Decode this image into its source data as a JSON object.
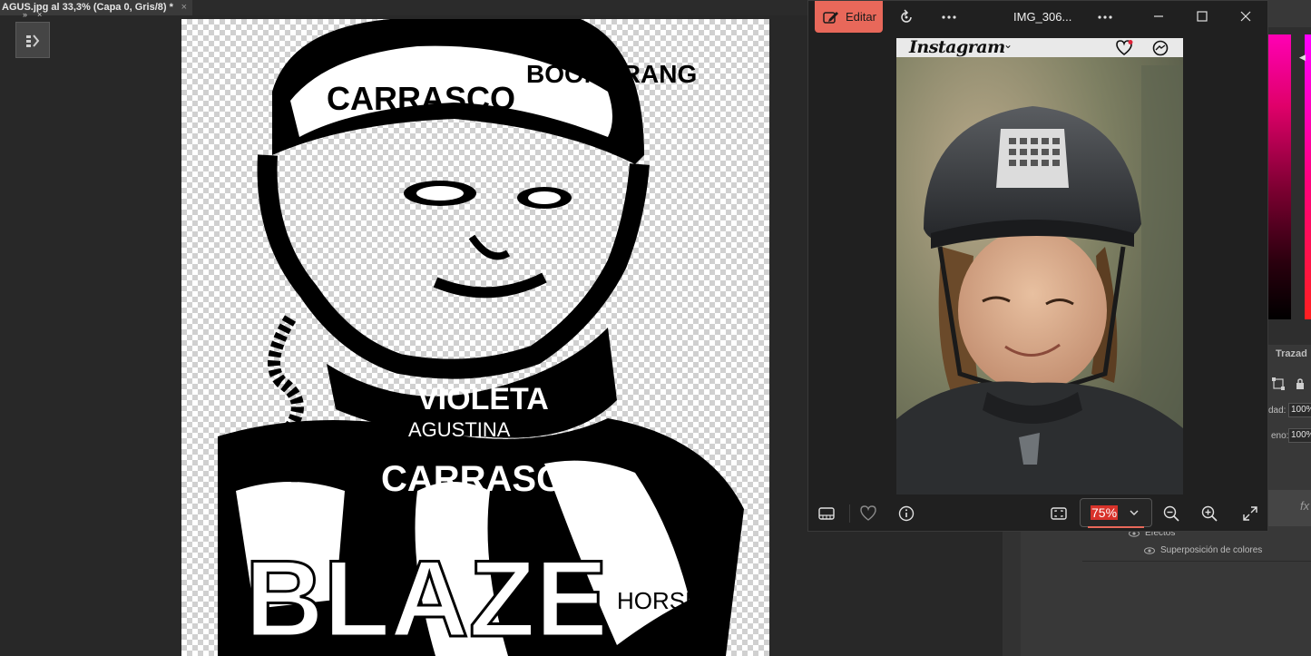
{
  "photoshop": {
    "document_tab": "AGUS.jpg al 33,3% (Capa 0, Gris/8) *",
    "tab_close": "×",
    "tool_header": {
      "expand": "»",
      "close": "×"
    },
    "right_panel": {
      "paths_tab": "Trazad",
      "opacity_label": "dad:",
      "opacity_value": "100%",
      "fill_label": "eno:",
      "fill_value": "100%",
      "fx_label": "fx"
    },
    "layers": {
      "effects_label": "Efectos",
      "color_overlay_label": "Superposición de colores"
    }
  },
  "canvas_artwork": {
    "words": [
      "AGUSTINA",
      "CARRASCO",
      "BOOMERANG",
      "HORSE",
      "BLAZE",
      "VIOLETA"
    ]
  },
  "photos_viewer": {
    "edit_label": "Editar",
    "title": "IMG_306...",
    "photo_header": {
      "app_name": "Instagram",
      "app_chevron": "⌄"
    },
    "zoom_value": "75%"
  },
  "colors": {
    "edit_button": "#e8685a",
    "zoom_highlight": "#d8322a",
    "viewer_bg": "#202020",
    "photoshop_bg": "#282828"
  },
  "icons": {
    "titlebar": [
      "edit-icon",
      "rotate-icon",
      "more-icon",
      "more-icon",
      "minimize-icon",
      "maximize-icon",
      "close-icon"
    ],
    "bottom": [
      "filmstrip-icon",
      "heart-icon",
      "info-icon",
      "fit-icon",
      "chevron-down-icon",
      "zoom-out-icon",
      "zoom-in-icon",
      "fullscreen-icon"
    ]
  }
}
